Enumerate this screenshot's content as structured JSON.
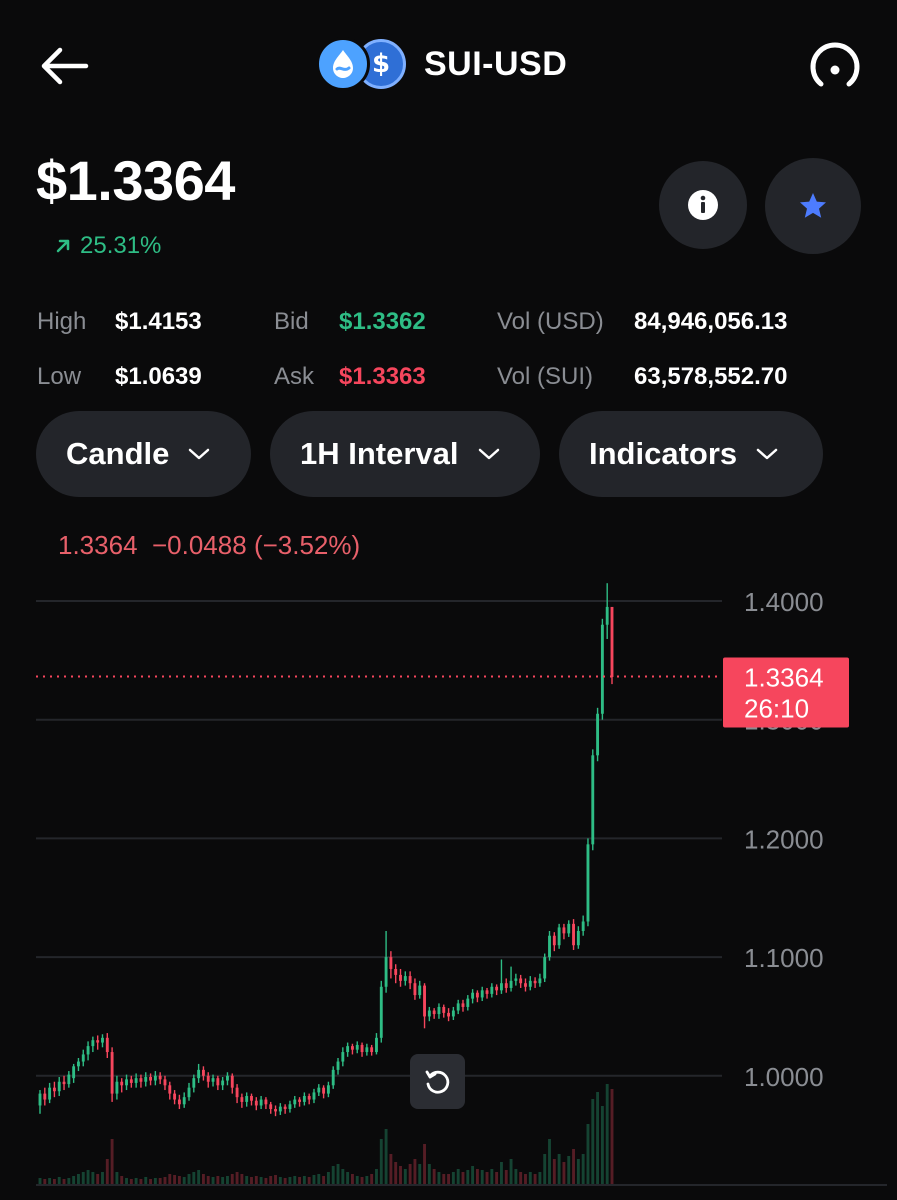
{
  "header": {
    "title": "SUI-USD",
    "coin_symbol": "$"
  },
  "price": "$1.3364",
  "change": "25.31%",
  "stats": {
    "high_label": "High",
    "high_value": "$1.4153",
    "low_label": "Low",
    "low_value": "$1.0639",
    "bid_label": "Bid",
    "bid_value": "$1.3362",
    "ask_label": "Ask",
    "ask_value": "$1.3363",
    "vol_usd_label": "Vol (USD)",
    "vol_usd_value": "84,946,056.13",
    "vol_sui_label": "Vol (SUI)",
    "vol_sui_value": "63,578,552.70"
  },
  "controls": {
    "chart_type": "Candle",
    "interval": "1H Interval",
    "indicators": "Indicators"
  },
  "legend": {
    "close": "1.3364",
    "change": "−0.0488",
    "change_pct": "(−3.52%)"
  },
  "colors": {
    "up": "#2ebd85",
    "down": "#f6465d",
    "accent": "#4da2ff",
    "star": "#4d7cfe"
  },
  "chart_data": {
    "type": "candlestick",
    "y_ticks": [
      "1.4000",
      "1.3000",
      "1.2000",
      "1.1000",
      "1.0000"
    ],
    "ylim": [
      0.965,
      1.415
    ],
    "current_price_label": "1.3364",
    "countdown": "26:10",
    "current_price": 1.3364,
    "candles": [
      [
        0.975,
        0.985,
        0.968,
        0.988
      ],
      [
        0.985,
        0.98,
        0.975,
        0.99
      ],
      [
        0.98,
        0.99,
        0.977,
        0.994
      ],
      [
        0.99,
        0.987,
        0.982,
        0.995
      ],
      [
        0.987,
        0.995,
        0.983,
        0.999
      ],
      [
        0.995,
        0.993,
        0.988,
        1.0
      ],
      [
        0.993,
        1.001,
        0.99,
        1.004
      ],
      [
        0.998,
        1.008,
        0.994,
        1.01
      ],
      [
        1.008,
        1.012,
        1.004,
        1.015
      ],
      [
        1.012,
        1.018,
        1.008,
        1.022
      ],
      [
        1.018,
        1.025,
        1.013,
        1.029
      ],
      [
        1.025,
        1.03,
        1.02,
        1.033
      ],
      [
        1.03,
        1.028,
        1.022,
        1.034
      ],
      [
        1.028,
        1.032,
        1.024,
        1.035
      ],
      [
        1.032,
        1.02,
        1.015,
        1.036
      ],
      [
        1.02,
        0.985,
        0.978,
        1.024
      ],
      [
        0.985,
        0.995,
        0.98,
        1.0
      ],
      [
        0.995,
        0.992,
        0.986,
        0.998
      ],
      [
        0.992,
        0.997,
        0.988,
        1.001
      ],
      [
        0.997,
        0.994,
        0.99,
        1.0
      ],
      [
        0.994,
        0.998,
        0.99,
        1.002
      ],
      [
        0.998,
        0.995,
        0.99,
        1.001
      ],
      [
        0.995,
        0.999,
        0.991,
        1.003
      ],
      [
        0.999,
        0.996,
        0.992,
        1.002
      ],
      [
        0.996,
        1.0,
        0.992,
        1.004
      ],
      [
        1.0,
        0.997,
        0.993,
        1.003
      ],
      [
        0.997,
        0.992,
        0.988,
        1.0
      ],
      [
        0.992,
        0.985,
        0.98,
        0.995
      ],
      [
        0.985,
        0.98,
        0.976,
        0.988
      ],
      [
        0.98,
        0.976,
        0.972,
        0.984
      ],
      [
        0.976,
        0.982,
        0.973,
        0.986
      ],
      [
        0.982,
        0.99,
        0.979,
        0.994
      ],
      [
        0.99,
        0.998,
        0.986,
        1.001
      ],
      [
        0.998,
        1.005,
        0.994,
        1.01
      ],
      [
        1.005,
        1.0,
        0.996,
        1.008
      ],
      [
        1.0,
        0.995,
        0.99,
        1.003
      ],
      [
        0.995,
        0.998,
        0.991,
        1.001
      ],
      [
        0.998,
        0.992,
        0.988,
        1.0
      ],
      [
        0.992,
        0.996,
        0.988,
        0.999
      ],
      [
        0.996,
        1.0,
        0.992,
        1.003
      ],
      [
        1.0,
        0.99,
        0.985,
        1.002
      ],
      [
        0.99,
        0.982,
        0.977,
        0.993
      ],
      [
        0.982,
        0.978,
        0.973,
        0.985
      ],
      [
        0.978,
        0.983,
        0.974,
        0.986
      ],
      [
        0.983,
        0.979,
        0.975,
        0.985
      ],
      [
        0.979,
        0.975,
        0.971,
        0.982
      ],
      [
        0.975,
        0.98,
        0.972,
        0.983
      ],
      [
        0.98,
        0.976,
        0.972,
        0.982
      ],
      [
        0.976,
        0.972,
        0.968,
        0.978
      ],
      [
        0.972,
        0.97,
        0.966,
        0.975
      ],
      [
        0.97,
        0.974,
        0.967,
        0.977
      ],
      [
        0.974,
        0.972,
        0.968,
        0.976
      ],
      [
        0.972,
        0.976,
        0.969,
        0.979
      ],
      [
        0.976,
        0.98,
        0.973,
        0.983
      ],
      [
        0.98,
        0.978,
        0.974,
        0.982
      ],
      [
        0.978,
        0.983,
        0.975,
        0.986
      ],
      [
        0.983,
        0.98,
        0.976,
        0.985
      ],
      [
        0.98,
        0.986,
        0.977,
        0.989
      ],
      [
        0.986,
        0.99,
        0.983,
        0.993
      ],
      [
        0.99,
        0.985,
        0.981,
        0.992
      ],
      [
        0.985,
        0.992,
        0.982,
        0.995
      ],
      [
        0.992,
        1.005,
        0.989,
        1.008
      ],
      [
        1.005,
        1.012,
        1.001,
        1.015
      ],
      [
        1.012,
        1.02,
        1.008,
        1.024
      ],
      [
        1.02,
        1.025,
        1.016,
        1.028
      ],
      [
        1.025,
        1.022,
        1.018,
        1.027
      ],
      [
        1.022,
        1.026,
        1.019,
        1.029
      ],
      [
        1.026,
        1.02,
        1.016,
        1.028
      ],
      [
        1.02,
        1.024,
        1.017,
        1.027
      ],
      [
        1.024,
        1.02,
        1.017,
        1.026
      ],
      [
        1.02,
        1.032,
        1.018,
        1.036
      ],
      [
        1.032,
        1.075,
        1.028,
        1.08
      ],
      [
        1.075,
        1.1,
        1.07,
        1.122
      ],
      [
        1.1,
        1.09,
        1.082,
        1.105
      ],
      [
        1.09,
        1.085,
        1.078,
        1.094
      ],
      [
        1.085,
        1.08,
        1.075,
        1.09
      ],
      [
        1.08,
        1.084,
        1.076,
        1.088
      ],
      [
        1.084,
        1.078,
        1.073,
        1.088
      ],
      [
        1.078,
        1.068,
        1.064,
        1.082
      ],
      [
        1.068,
        1.076,
        1.065,
        1.08
      ],
      [
        1.076,
        1.05,
        1.04,
        1.078
      ],
      [
        1.05,
        1.055,
        1.046,
        1.058
      ],
      [
        1.055,
        1.052,
        1.048,
        1.057
      ],
      [
        1.052,
        1.058,
        1.048,
        1.061
      ],
      [
        1.058,
        1.053,
        1.049,
        1.06
      ],
      [
        1.053,
        1.05,
        1.046,
        1.057
      ],
      [
        1.05,
        1.055,
        1.047,
        1.058
      ],
      [
        1.055,
        1.061,
        1.052,
        1.064
      ],
      [
        1.061,
        1.058,
        1.054,
        1.064
      ],
      [
        1.058,
        1.065,
        1.055,
        1.068
      ],
      [
        1.065,
        1.07,
        1.061,
        1.073
      ],
      [
        1.07,
        1.066,
        1.062,
        1.072
      ],
      [
        1.066,
        1.072,
        1.063,
        1.075
      ],
      [
        1.072,
        1.069,
        1.065,
        1.074
      ],
      [
        1.069,
        1.075,
        1.066,
        1.078
      ],
      [
        1.075,
        1.072,
        1.068,
        1.077
      ],
      [
        1.072,
        1.078,
        1.069,
        1.098
      ],
      [
        1.078,
        1.074,
        1.07,
        1.082
      ],
      [
        1.074,
        1.08,
        1.071,
        1.092
      ],
      [
        1.08,
        1.082,
        1.076,
        1.086
      ],
      [
        1.082,
        1.078,
        1.074,
        1.085
      ],
      [
        1.078,
        1.075,
        1.071,
        1.082
      ],
      [
        1.075,
        1.08,
        1.072,
        1.084
      ],
      [
        1.08,
        1.078,
        1.074,
        1.083
      ],
      [
        1.078,
        1.082,
        1.075,
        1.086
      ],
      [
        1.082,
        1.1,
        1.079,
        1.103
      ],
      [
        1.1,
        1.118,
        1.097,
        1.122
      ],
      [
        1.118,
        1.11,
        1.105,
        1.121
      ],
      [
        1.11,
        1.125,
        1.107,
        1.128
      ],
      [
        1.125,
        1.12,
        1.115,
        1.128
      ],
      [
        1.12,
        1.128,
        1.117,
        1.131
      ],
      [
        1.128,
        1.11,
        1.106,
        1.132
      ],
      [
        1.11,
        1.122,
        1.107,
        1.126
      ],
      [
        1.122,
        1.13,
        1.118,
        1.135
      ],
      [
        1.13,
        1.195,
        1.126,
        1.2
      ],
      [
        1.195,
        1.27,
        1.19,
        1.275
      ],
      [
        1.27,
        1.305,
        1.265,
        1.31
      ],
      [
        1.305,
        1.38,
        1.3,
        1.385
      ],
      [
        1.38,
        1.395,
        1.368,
        1.415
      ],
      [
        1.395,
        1.336,
        1.33,
        1.392
      ]
    ],
    "volumes": [
      0.06,
      0.05,
      0.06,
      0.05,
      0.07,
      0.05,
      0.06,
      0.08,
      0.1,
      0.12,
      0.14,
      0.12,
      0.1,
      0.12,
      0.25,
      0.45,
      0.12,
      0.08,
      0.06,
      0.05,
      0.06,
      0.05,
      0.07,
      0.05,
      0.06,
      0.06,
      0.07,
      0.1,
      0.09,
      0.08,
      0.07,
      0.1,
      0.12,
      0.14,
      0.1,
      0.08,
      0.07,
      0.08,
      0.07,
      0.08,
      0.1,
      0.12,
      0.1,
      0.08,
      0.07,
      0.08,
      0.07,
      0.06,
      0.08,
      0.09,
      0.07,
      0.06,
      0.07,
      0.08,
      0.07,
      0.08,
      0.07,
      0.09,
      0.1,
      0.08,
      0.12,
      0.18,
      0.2,
      0.15,
      0.12,
      0.1,
      0.08,
      0.07,
      0.08,
      0.1,
      0.15,
      0.45,
      0.55,
      0.3,
      0.22,
      0.18,
      0.15,
      0.2,
      0.25,
      0.2,
      0.4,
      0.2,
      0.15,
      0.12,
      0.1,
      0.1,
      0.12,
      0.15,
      0.12,
      0.14,
      0.18,
      0.15,
      0.14,
      0.12,
      0.15,
      0.12,
      0.22,
      0.14,
      0.25,
      0.15,
      0.12,
      0.1,
      0.12,
      0.1,
      0.12,
      0.3,
      0.45,
      0.25,
      0.3,
      0.22,
      0.28,
      0.35,
      0.25,
      0.3,
      0.6,
      0.85,
      0.92,
      0.78,
      1.0,
      0.95
    ]
  }
}
